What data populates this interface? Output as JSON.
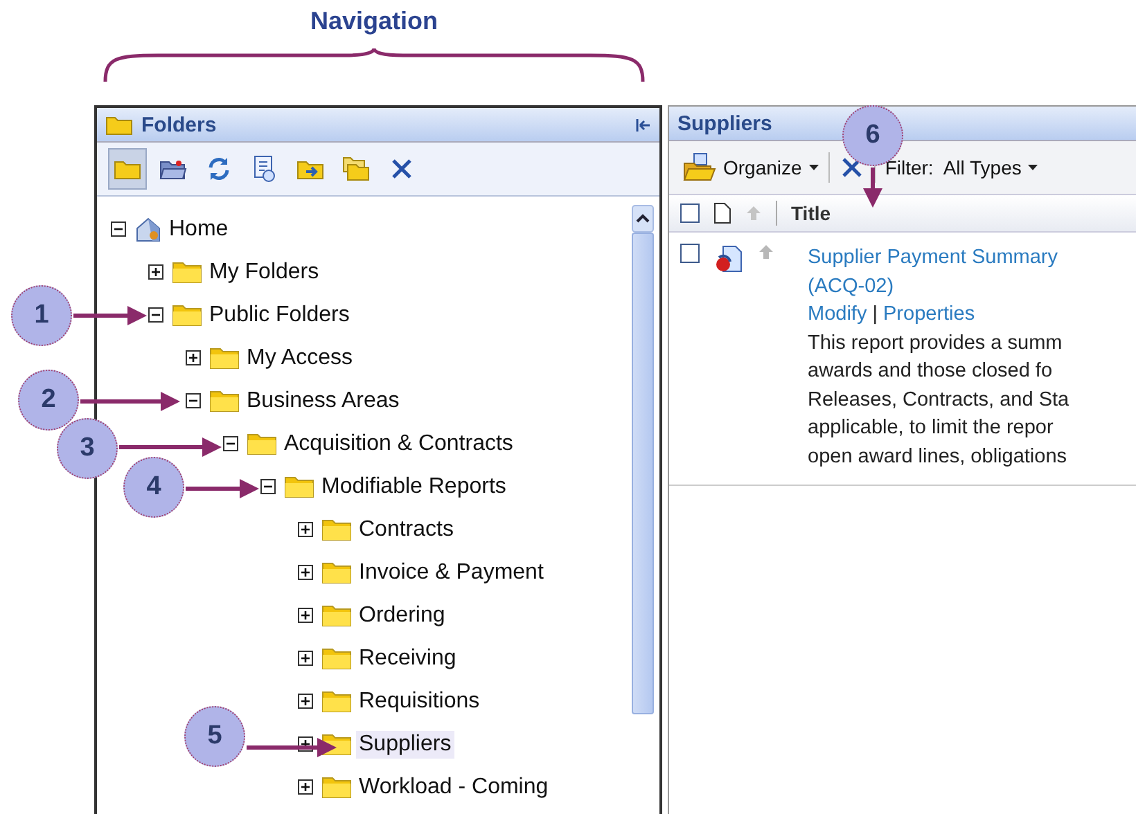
{
  "annotation": {
    "label": "Navigation"
  },
  "callouts": [
    {
      "number": "1"
    },
    {
      "number": "2"
    },
    {
      "number": "3"
    },
    {
      "number": "4"
    },
    {
      "number": "5"
    },
    {
      "number": "6"
    }
  ],
  "folders_panel": {
    "title": "Folders",
    "tools": [
      {
        "kind": "folder",
        "selected": true
      },
      {
        "kind": "open-folder",
        "selected": false
      },
      {
        "kind": "refresh",
        "selected": false
      },
      {
        "kind": "properties",
        "selected": false
      },
      {
        "kind": "move",
        "selected": false
      },
      {
        "kind": "copy",
        "selected": false
      },
      {
        "kind": "delete",
        "selected": false
      }
    ],
    "tree": [
      {
        "label": "Home",
        "kind": "home",
        "expanded": true,
        "selected": false,
        "children": [
          {
            "label": "My Folders",
            "kind": "folder",
            "expanded": false,
            "selected": false
          },
          {
            "label": "Public Folders",
            "kind": "folder",
            "expanded": true,
            "selected": false,
            "children": [
              {
                "label": "My Access",
                "kind": "folder",
                "expanded": false,
                "selected": false
              },
              {
                "label": "Business Areas",
                "kind": "folder",
                "expanded": true,
                "selected": false,
                "children": [
                  {
                    "label": "Acquisition & Contracts",
                    "kind": "folder",
                    "expanded": true,
                    "selected": false,
                    "children": [
                      {
                        "label": "Modifiable Reports",
                        "kind": "folder",
                        "expanded": true,
                        "selected": false,
                        "children": [
                          {
                            "label": "Contracts",
                            "kind": "folder",
                            "expanded": false,
                            "selected": false
                          },
                          {
                            "label": "Invoice & Payment",
                            "kind": "folder",
                            "expanded": false,
                            "selected": false
                          },
                          {
                            "label": "Ordering",
                            "kind": "folder",
                            "expanded": false,
                            "selected": false
                          },
                          {
                            "label": "Receiving",
                            "kind": "folder",
                            "expanded": false,
                            "selected": false
                          },
                          {
                            "label": "Requisitions",
                            "kind": "folder",
                            "expanded": false,
                            "selected": false
                          },
                          {
                            "label": "Suppliers",
                            "kind": "folder",
                            "expanded": false,
                            "selected": true
                          },
                          {
                            "label": "Workload - Coming",
                            "kind": "folder",
                            "expanded": false,
                            "selected": false
                          }
                        ]
                      }
                    ]
                  }
                ]
              }
            ]
          }
        ]
      }
    ]
  },
  "suppliers_panel": {
    "title": "Suppliers",
    "organize": "Organize",
    "filter_label": "Filter:",
    "filter_value": "All Types",
    "column": "Title",
    "all_checked": false,
    "rows": [
      {
        "checked": false,
        "title": "Supplier Payment Summary",
        "code": "(ACQ-02)",
        "modify": "Modify",
        "separator": "|",
        "properties": "Properties",
        "description": [
          "This report provides a summ",
          "awards and those closed fo",
          "Releases, Contracts, and Sta",
          "applicable, to limit the repor",
          "open award lines, obligations"
        ]
      }
    ]
  }
}
